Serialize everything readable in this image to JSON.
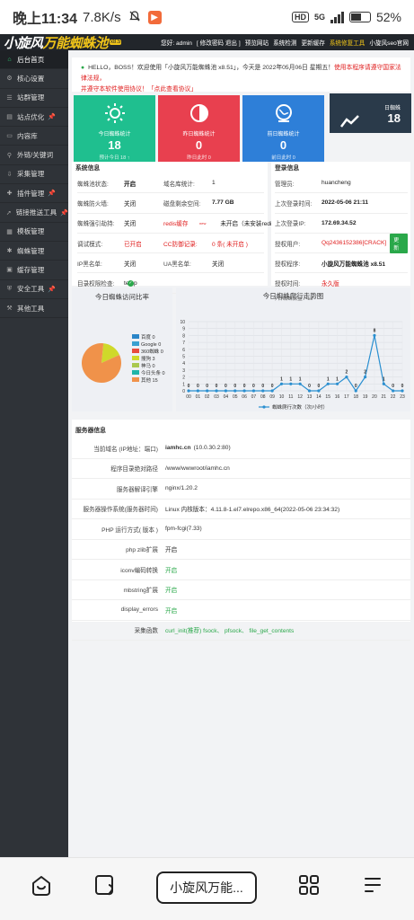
{
  "status_bar": {
    "time": "晚上11:34",
    "speed": "7.8K/s",
    "hd": "HD",
    "network": "5G",
    "battery": "52%"
  },
  "topbar": {
    "logo_main": "小旋风",
    "logo_accent": "万能蜘蛛池",
    "version": "x8.5",
    "menu": [
      {
        "label": "您好: admin"
      },
      {
        "label": "[ 修改密码 退出 ]"
      },
      {
        "label": "预览网站"
      },
      {
        "label": "系统检测"
      },
      {
        "label": "更新缓存"
      },
      {
        "label": "系统修复工具",
        "highlight": true
      },
      {
        "label": "小旋风seo官网"
      }
    ]
  },
  "sidebar": {
    "items": [
      {
        "label": "后台首页",
        "icon": "home-icon",
        "active": true
      },
      {
        "label": "核心设置",
        "icon": "gear-icon"
      },
      {
        "label": "站群管理",
        "icon": "list-icon"
      },
      {
        "label": "站点优化",
        "icon": "chart-icon",
        "pin": true
      },
      {
        "label": "内容库",
        "icon": "book-icon"
      },
      {
        "label": "外链/关键词",
        "icon": "link-icon"
      },
      {
        "label": "采集管理",
        "icon": "download-icon"
      },
      {
        "label": "插件管理",
        "icon": "puzzle-icon",
        "pin": true
      },
      {
        "label": "链接推送工具",
        "icon": "send-icon",
        "pin": true
      },
      {
        "label": "模板管理",
        "icon": "template-icon"
      },
      {
        "label": "蜘蛛管理",
        "icon": "spider-icon"
      },
      {
        "label": "缓存管理",
        "icon": "cache-icon"
      },
      {
        "label": "安全工具",
        "icon": "shield-icon",
        "pin": true
      },
      {
        "label": "其他工具",
        "icon": "tools-icon"
      }
    ]
  },
  "notice": {
    "line1_a": "HELLO，BOSS！欢迎使用「小旋风万能蜘蛛池 x8.51」，今天是 2022年05月06日 星期五！",
    "line1_b": "使用本程序请遵守国家法律法规，",
    "line2": "并遵守本软件使用协议！「点此查看协议」"
  },
  "cards": [
    {
      "label": "今日蜘蛛统计",
      "value": "18",
      "sub": "预计今日 18 ↑",
      "color": "#1fbf8f",
      "icon": "sun-icon"
    },
    {
      "label": "昨日蜘蛛统计",
      "value": "0",
      "sub": "昨日此时 0",
      "color": "#e8404f",
      "icon": "half-circle-icon"
    },
    {
      "label": "前日蜘蛛统计",
      "value": "0",
      "sub": "前日此时 0",
      "color": "#2e7fd8",
      "icon": "globe-icon"
    },
    {
      "label": "日蜘蛛",
      "value": "18",
      "color": "#2a3a4a",
      "icon": "trend-icon"
    }
  ],
  "system_info": {
    "title": "系统信息",
    "rows": [
      [
        {
          "k": "蜘蛛池状态:",
          "v": "开启",
          "bold": true
        },
        {
          "k": "域名库统计:",
          "v": "1"
        }
      ],
      [
        {
          "k": "蜘蛛防火墙:",
          "v": "关闭"
        },
        {
          "k": "磁盘剩余空间:",
          "v": "7.77 GB",
          "bold": true
        }
      ],
      [
        {
          "k": "蜘蛛强引劫持:",
          "v": "关闭"
        },
        {
          "k": "redis缓存",
          "v": "未开启（未安装redis扩展）",
          "red_key": true,
          "sup": "new"
        }
      ],
      [
        {
          "k": "调试模式:",
          "v": "已开启",
          "red": true
        },
        {
          "k": "CC防御记录:",
          "v": "0 条( 未开启 )",
          "red": true,
          "red_key": true
        }
      ],
      [
        {
          "k": "IP黑名单:",
          "v": "关闭"
        },
        {
          "k": "UA黑名单:",
          "v": "关闭"
        }
      ],
      [
        {
          "k": "目录权限检查:",
          "v": "temp",
          "check": true
        }
      ]
    ]
  },
  "login_info": {
    "title": "登录信息",
    "rows": [
      {
        "k": "管理员:",
        "v": "huancheng"
      },
      {
        "k": "上次登录时间:",
        "v": "2022-05-06 21:11",
        "bold": true
      },
      {
        "k": "上次登录IP:",
        "v": "172.69.34.52",
        "bold": true
      },
      {
        "k": "授权用户:",
        "v": "Qq2436152386[CRACK]",
        "red": true,
        "button": "更新"
      },
      {
        "k": "授权程序:",
        "v": "小旋风万能蜘蛛池 x8.51",
        "bold": true
      },
      {
        "k": "授权时间:",
        "v": "永久版",
        "red": true
      }
    ]
  },
  "pie_panel": {
    "title": "今日蜘蛛访问比率"
  },
  "line_panel": {
    "title": "今日蜘蛛爬行走势图"
  },
  "chart_data": [
    {
      "type": "pie",
      "title": "今日蜘蛛访问比率",
      "labels": [
        "百度",
        "Google",
        "360蜘蛛",
        "搜狗",
        "神马",
        "今日头条",
        "其他"
      ],
      "values": [
        0,
        0,
        0,
        3,
        0,
        0,
        15
      ],
      "colors": [
        "#2b86c8",
        "#3aa0d0",
        "#e84c3d",
        "#cfd92a",
        "#a9c84f",
        "#1fb5a8",
        "#f0924a"
      ]
    },
    {
      "type": "line",
      "title": "今日蜘蛛爬行走势图",
      "subtitle": "今日蜘蛛数量：18",
      "categories": [
        "00",
        "01",
        "02",
        "03",
        "04",
        "05",
        "06",
        "07",
        "08",
        "09",
        "10",
        "11",
        "12",
        "13",
        "14",
        "15",
        "16",
        "17",
        "18",
        "19",
        "20",
        "21",
        "22",
        "23"
      ],
      "series": [
        {
          "name": "蜘蛛爬行次数（次/小时）",
          "values": [
            0,
            0,
            0,
            0,
            0,
            0,
            0,
            0,
            0,
            0,
            1,
            1,
            1,
            0,
            0,
            1,
            1,
            2,
            0,
            2,
            8,
            1,
            0,
            0
          ],
          "color": "#2a8fd0"
        }
      ],
      "yticks": [
        "0",
        "1",
        "2",
        "3",
        "4",
        "5",
        "6",
        "7",
        "8",
        "9",
        "10"
      ],
      "ylim": [
        0,
        10
      ],
      "grid": true,
      "legend": "bottom"
    }
  ],
  "server_info": {
    "title": "服务器信息",
    "rows": [
      {
        "k": "当前域名 (IP地址：端口)",
        "v": "iamhc.cn",
        "v2": "(10.0.30.2:80)"
      },
      {
        "k": "程序目录绝对路径",
        "v": "/www/wwwroot/iamhc.cn"
      },
      {
        "k": "服务器解译引擎",
        "v": "nginx/1.20.2"
      },
      {
        "k": "服务器操作系统(服务器时间)",
        "v": "Linux 内核版本：4.11.8-1.el7.elrepo.x86_64(2022-05-06 23:34:32)"
      },
      {
        "k": "PHP 运行方式( 版本 )",
        "v": "fpm-fcgi(7.33)"
      },
      {
        "k": "php zlib扩展",
        "v": "开启"
      },
      {
        "k": "iconv编码转换",
        "v": "开启",
        "green": true
      },
      {
        "k": "mbstring扩展",
        "v": "开启",
        "green": true
      },
      {
        "k": "display_errors",
        "v": "开启",
        "green": true
      },
      {
        "k": "采集函数",
        "v": "curl_init(推荐) fsock、 pfsock、 file_get_contents",
        "green": true
      }
    ]
  },
  "bottom_nav": {
    "tab_label": "小旋风万能..."
  }
}
